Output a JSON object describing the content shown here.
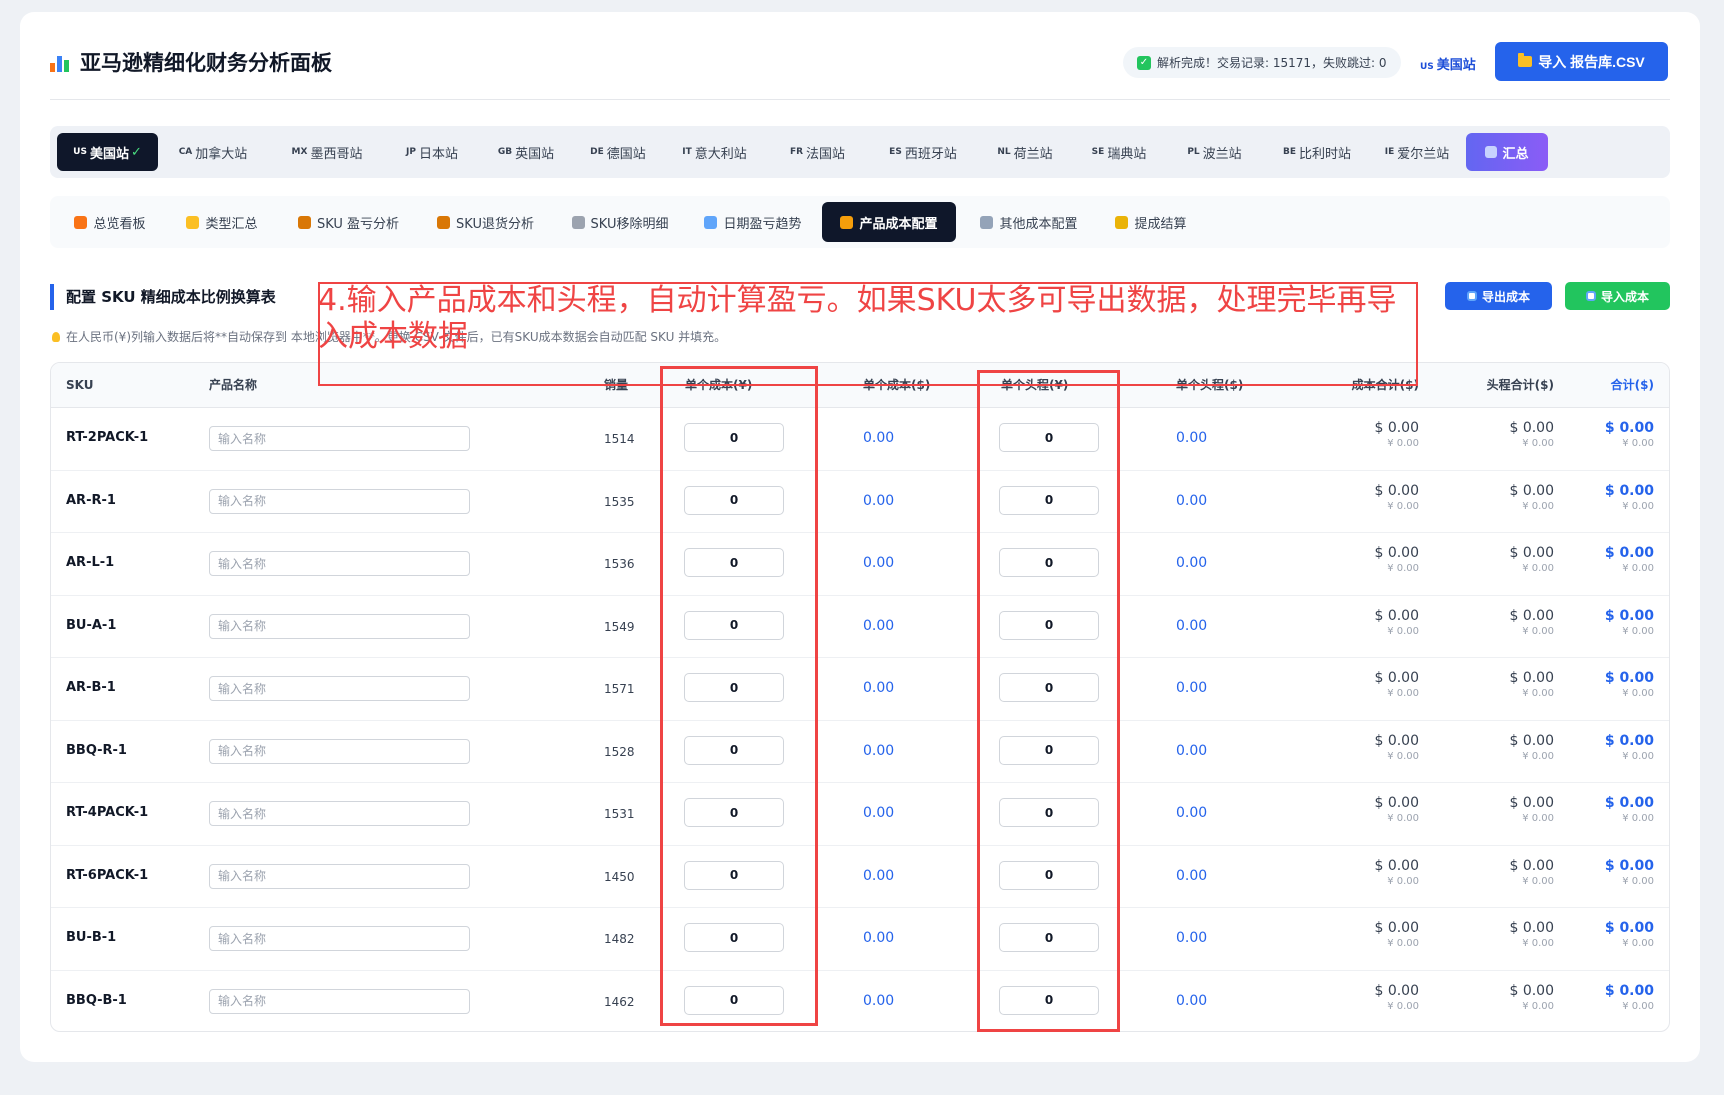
{
  "app": {
    "title": "亚马逊精细化财务分析面板",
    "status_text": "解析完成！交易记录: 15171，失败跳过: 0",
    "site_code": "US",
    "site_label": "美国站",
    "import_label": "导入 报告库.CSV"
  },
  "sites": [
    {
      "code": "US",
      "label": "美国站",
      "active": true,
      "mark": "✓"
    },
    {
      "code": "CA",
      "label": "加拿大站"
    },
    {
      "code": "MX",
      "label": "墨西哥站"
    },
    {
      "code": "JP",
      "label": "日本站"
    },
    {
      "code": "GB",
      "label": "英国站"
    },
    {
      "code": "DE",
      "label": "德国站"
    },
    {
      "code": "IT",
      "label": "意大利站"
    },
    {
      "code": "FR",
      "label": "法国站"
    },
    {
      "code": "ES",
      "label": "西班牙站"
    },
    {
      "code": "NL",
      "label": "荷兰站"
    },
    {
      "code": "SE",
      "label": "瑞典站"
    },
    {
      "code": "PL",
      "label": "波兰站"
    },
    {
      "code": "BE",
      "label": "比利时站"
    },
    {
      "code": "IE",
      "label": "爱尔兰站"
    },
    {
      "code": "",
      "label": "汇总",
      "summary": true
    }
  ],
  "nav": [
    {
      "label": "总览看板",
      "icon": "house-icon"
    },
    {
      "label": "类型汇总",
      "icon": "folder-icon"
    },
    {
      "label": "SKU 盈亏分析",
      "icon": "box-icon"
    },
    {
      "label": "SKU退货分析",
      "icon": "box-icon"
    },
    {
      "label": "SKU移除明细",
      "icon": "trash-icon"
    },
    {
      "label": "日期盈亏趋势",
      "icon": "calendar-icon"
    },
    {
      "label": "产品成本配置",
      "icon": "money-bag-icon",
      "active": true
    },
    {
      "label": "其他成本配置",
      "icon": "gear-icon"
    },
    {
      "label": "提成结算",
      "icon": "medal-icon"
    }
  ],
  "section": {
    "title": "配置 SKU 精细成本比例换算表",
    "hint": "在人民币(¥)列输入数据后将**自动保存到 本地浏览器中**。更换 CSV 文件后，已有SKU成本数据会自动匹配 SKU 并填充。",
    "export_label": "导出成本",
    "import_label": "导入成本"
  },
  "table": {
    "headers": [
      "SKU",
      "产品名称",
      "销量",
      "单个成本(¥)",
      "单个成本($)",
      "单个头程(¥)",
      "单个头程($)",
      "成本合计($)",
      "头程合计($)",
      "合计($)"
    ],
    "name_placeholder": "输入名称",
    "rows": [
      {
        "sku": "RT-2PACK-1",
        "qty": "1514",
        "cost_cny": "0",
        "cost_usd": "0.00",
        "freight_cny": "0",
        "freight_usd": "0.00",
        "cost_total_usd": "$ 0.00",
        "cost_total_cny": "¥ 0.00",
        "freight_total_usd": "$ 0.00",
        "freight_total_cny": "¥ 0.00",
        "total_usd": "$ 0.00",
        "total_cny": "¥ 0.00"
      },
      {
        "sku": "AR-R-1",
        "qty": "1535",
        "cost_cny": "0",
        "cost_usd": "0.00",
        "freight_cny": "0",
        "freight_usd": "0.00",
        "cost_total_usd": "$ 0.00",
        "cost_total_cny": "¥ 0.00",
        "freight_total_usd": "$ 0.00",
        "freight_total_cny": "¥ 0.00",
        "total_usd": "$ 0.00",
        "total_cny": "¥ 0.00"
      },
      {
        "sku": "AR-L-1",
        "qty": "1536",
        "cost_cny": "0",
        "cost_usd": "0.00",
        "freight_cny": "0",
        "freight_usd": "0.00",
        "cost_total_usd": "$ 0.00",
        "cost_total_cny": "¥ 0.00",
        "freight_total_usd": "$ 0.00",
        "freight_total_cny": "¥ 0.00",
        "total_usd": "$ 0.00",
        "total_cny": "¥ 0.00"
      },
      {
        "sku": "BU-A-1",
        "qty": "1549",
        "cost_cny": "0",
        "cost_usd": "0.00",
        "freight_cny": "0",
        "freight_usd": "0.00",
        "cost_total_usd": "$ 0.00",
        "cost_total_cny": "¥ 0.00",
        "freight_total_usd": "$ 0.00",
        "freight_total_cny": "¥ 0.00",
        "total_usd": "$ 0.00",
        "total_cny": "¥ 0.00"
      },
      {
        "sku": "AR-B-1",
        "qty": "1571",
        "cost_cny": "0",
        "cost_usd": "0.00",
        "freight_cny": "0",
        "freight_usd": "0.00",
        "cost_total_usd": "$ 0.00",
        "cost_total_cny": "¥ 0.00",
        "freight_total_usd": "$ 0.00",
        "freight_total_cny": "¥ 0.00",
        "total_usd": "$ 0.00",
        "total_cny": "¥ 0.00"
      },
      {
        "sku": "BBQ-R-1",
        "qty": "1528",
        "cost_cny": "0",
        "cost_usd": "0.00",
        "freight_cny": "0",
        "freight_usd": "0.00",
        "cost_total_usd": "$ 0.00",
        "cost_total_cny": "¥ 0.00",
        "freight_total_usd": "$ 0.00",
        "freight_total_cny": "¥ 0.00",
        "total_usd": "$ 0.00",
        "total_cny": "¥ 0.00"
      },
      {
        "sku": "RT-4PACK-1",
        "qty": "1531",
        "cost_cny": "0",
        "cost_usd": "0.00",
        "freight_cny": "0",
        "freight_usd": "0.00",
        "cost_total_usd": "$ 0.00",
        "cost_total_cny": "¥ 0.00",
        "freight_total_usd": "$ 0.00",
        "freight_total_cny": "¥ 0.00",
        "total_usd": "$ 0.00",
        "total_cny": "¥ 0.00"
      },
      {
        "sku": "RT-6PACK-1",
        "qty": "1450",
        "cost_cny": "0",
        "cost_usd": "0.00",
        "freight_cny": "0",
        "freight_usd": "0.00",
        "cost_total_usd": "$ 0.00",
        "cost_total_cny": "¥ 0.00",
        "freight_total_usd": "$ 0.00",
        "freight_total_cny": "¥ 0.00",
        "total_usd": "$ 0.00",
        "total_cny": "¥ 0.00"
      },
      {
        "sku": "BU-B-1",
        "qty": "1482",
        "cost_cny": "0",
        "cost_usd": "0.00",
        "freight_cny": "0",
        "freight_usd": "0.00",
        "cost_total_usd": "$ 0.00",
        "cost_total_cny": "¥ 0.00",
        "freight_total_usd": "$ 0.00",
        "freight_total_cny": "¥ 0.00",
        "total_usd": "$ 0.00",
        "total_cny": "¥ 0.00"
      },
      {
        "sku": "BBQ-B-1",
        "qty": "1462",
        "cost_cny": "0",
        "cost_usd": "0.00",
        "freight_cny": "0",
        "freight_usd": "0.00",
        "cost_total_usd": "$ 0.00",
        "cost_total_cny": "¥ 0.00",
        "freight_total_usd": "$ 0.00",
        "freight_total_cny": "¥ 0.00",
        "total_usd": "$ 0.00",
        "total_cny": "¥ 0.00"
      }
    ]
  },
  "annotation": {
    "text": "4.输入产品成本和头程，自动计算盈亏。如果SKU太多可导出数据，处理完毕再导入成本数据",
    "color": "#ef4444"
  },
  "colors": {
    "accent": "#2563eb",
    "success": "#22c55e",
    "dark": "#0f172a"
  }
}
